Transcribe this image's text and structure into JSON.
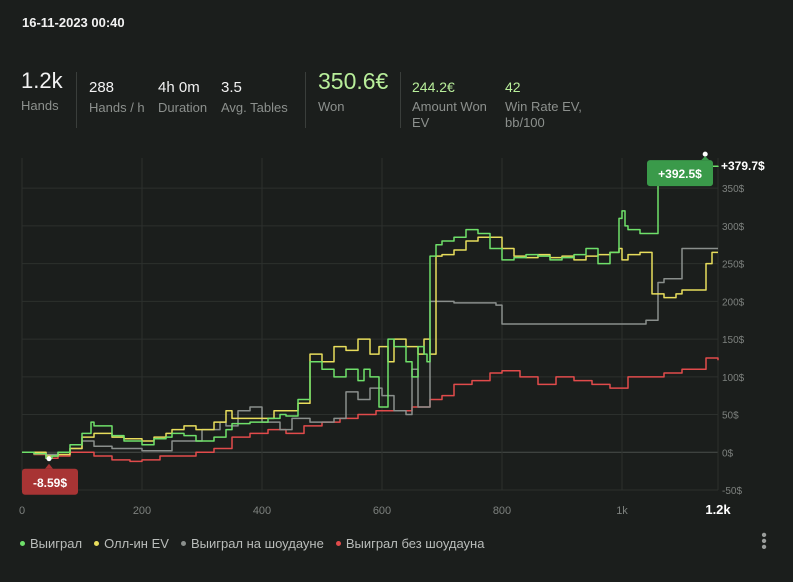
{
  "timestamp": "16-11-2023 00:40",
  "stats": {
    "hands": {
      "value": "1.2k",
      "label": "Hands"
    },
    "hands_per_hour": {
      "value": "288",
      "label": "Hands / h"
    },
    "duration": {
      "value": "4h 0m",
      "label": "Duration"
    },
    "avg_tables": {
      "value": "3.5",
      "label": "Avg. Tables"
    },
    "won": {
      "value": "350.6€",
      "label": "Won"
    },
    "amount_won_ev": {
      "value": "244.2€",
      "label_line1": "Amount Won",
      "label_line2": "EV"
    },
    "win_rate_ev": {
      "value": "42",
      "label_line1": "Win Rate EV,",
      "label_line2": "bb/100"
    }
  },
  "chart_data": {
    "type": "line",
    "x_ticks": [
      {
        "v": 0,
        "label": "0"
      },
      {
        "v": 200,
        "label": "200"
      },
      {
        "v": 400,
        "label": "400"
      },
      {
        "v": 600,
        "label": "600"
      },
      {
        "v": 800,
        "label": "800"
      },
      {
        "v": 1000,
        "label": "1k"
      },
      {
        "v": 1160,
        "label": "1.2k"
      }
    ],
    "y_ticks": [
      {
        "v": 350,
        "label": "350$"
      },
      {
        "v": 300,
        "label": "300$"
      },
      {
        "v": 250,
        "label": "250$"
      },
      {
        "v": 200,
        "label": "200$"
      },
      {
        "v": 150,
        "label": "150$"
      },
      {
        "v": 100,
        "label": "100$"
      },
      {
        "v": 50,
        "label": "50$"
      },
      {
        "v": 0,
        "label": "0$"
      },
      {
        "v": -50,
        "label": "-50$"
      }
    ],
    "xlim": [
      0,
      1160
    ],
    "ylim": [
      -50,
      390
    ],
    "max_label": "+392.5$",
    "min_label": "-8.59$",
    "end_label": "+379.7$",
    "max_point": {
      "x": 1142,
      "y": 392.5
    },
    "min_point": {
      "x": 45,
      "y": -8.59
    },
    "series": [
      {
        "name": "Выиграл",
        "color": "#6fe06a",
        "x": [
          0,
          20,
          40,
          50,
          60,
          80,
          100,
          115,
          120,
          150,
          170,
          200,
          220,
          240,
          250,
          270,
          290,
          320,
          340,
          350,
          380,
          390,
          410,
          430,
          440,
          460,
          480,
          500,
          520,
          540,
          560,
          570,
          580,
          595,
          610,
          620,
          640,
          650,
          660,
          670,
          675,
          680,
          690,
          700,
          720,
          740,
          760,
          780,
          800,
          820,
          840,
          860,
          880,
          900,
          920,
          940,
          960,
          980,
          995,
          1000,
          1005,
          1010,
          1030,
          1060,
          1080,
          1100,
          1120,
          1130,
          1142,
          1150,
          1160
        ],
        "y": [
          0,
          -2,
          -8,
          -5,
          0,
          10,
          25,
          40,
          35,
          22,
          15,
          10,
          18,
          20,
          25,
          22,
          15,
          20,
          30,
          38,
          40,
          40,
          45,
          50,
          48,
          70,
          120,
          110,
          100,
          110,
          95,
          110,
          100,
          60,
          150,
          140,
          120,
          100,
          140,
          130,
          120,
          260,
          275,
          280,
          285,
          295,
          290,
          270,
          255,
          258,
          262,
          260,
          255,
          258,
          262,
          270,
          250,
          265,
          310,
          320,
          300,
          295,
          290,
          360,
          370,
          375,
          378,
          380,
          380,
          379,
          379.7
        ]
      },
      {
        "name": "Олл-ин EV",
        "color": "#e8dd5c",
        "x": [
          0,
          40,
          60,
          80,
          100,
          120,
          150,
          170,
          200,
          220,
          240,
          250,
          270,
          290,
          320,
          340,
          350,
          380,
          400,
          420,
          440,
          460,
          480,
          500,
          520,
          540,
          560,
          580,
          595,
          610,
          620,
          640,
          660,
          670,
          680,
          690,
          700,
          720,
          740,
          760,
          780,
          800,
          820,
          840,
          860,
          880,
          900,
          920,
          940,
          960,
          980,
          995,
          1000,
          1010,
          1030,
          1050,
          1070,
          1090,
          1100,
          1110,
          1120,
          1140,
          1150,
          1160
        ],
        "y": [
          0,
          -5,
          -3,
          5,
          20,
          25,
          20,
          18,
          15,
          20,
          25,
          30,
          35,
          30,
          40,
          55,
          45,
          45,
          45,
          55,
          55,
          65,
          130,
          120,
          140,
          135,
          150,
          130,
          140,
          120,
          150,
          140,
          130,
          150,
          130,
          260,
          262,
          268,
          280,
          285,
          285,
          270,
          260,
          258,
          262,
          258,
          260,
          255,
          260,
          262,
          265,
          270,
          255,
          262,
          265,
          210,
          205,
          210,
          215,
          215,
          215,
          250,
          265,
          265
        ]
      },
      {
        "name": "Выиграл на шоудауне",
        "color": "#8a8f8c",
        "x": [
          0,
          40,
          60,
          80,
          100,
          120,
          150,
          200,
          250,
          300,
          330,
          340,
          360,
          380,
          400,
          430,
          450,
          480,
          500,
          520,
          540,
          560,
          580,
          600,
          620,
          640,
          650,
          660,
          680,
          700,
          720,
          740,
          760,
          790,
          800,
          820,
          840,
          860,
          880,
          900,
          920,
          940,
          960,
          980,
          1000,
          1020,
          1040,
          1060,
          1070,
          1080,
          1100,
          1120,
          1140,
          1150,
          1160
        ],
        "y": [
          0,
          -3,
          0,
          5,
          15,
          8,
          5,
          2,
          15,
          30,
          40,
          35,
          55,
          60,
          40,
          30,
          45,
          40,
          40,
          45,
          80,
          70,
          85,
          75,
          55,
          50,
          110,
          60,
          200,
          200,
          198,
          198,
          198,
          195,
          170,
          170,
          170,
          170,
          170,
          170,
          170,
          170,
          170,
          170,
          170,
          170,
          175,
          225,
          230,
          230,
          270,
          270,
          270,
          270,
          270
        ]
      },
      {
        "name": "Выиграл без шоудауна",
        "color": "#e14b4b",
        "x": [
          0,
          20,
          40,
          60,
          80,
          100,
          120,
          150,
          180,
          200,
          230,
          260,
          290,
          320,
          350,
          380,
          410,
          440,
          470,
          500,
          530,
          560,
          590,
          620,
          650,
          680,
          700,
          720,
          750,
          780,
          800,
          830,
          860,
          890,
          920,
          950,
          980,
          1010,
          1040,
          1070,
          1100,
          1120,
          1140,
          1150,
          1160
        ],
        "y": [
          0,
          -3,
          -8,
          -5,
          0,
          0,
          -5,
          -10,
          -12,
          -10,
          -5,
          -5,
          0,
          5,
          20,
          25,
          30,
          25,
          35,
          40,
          45,
          50,
          55,
          55,
          60,
          70,
          75,
          90,
          95,
          105,
          108,
          100,
          90,
          100,
          95,
          90,
          85,
          100,
          100,
          105,
          110,
          110,
          125,
          125,
          122
        ]
      }
    ]
  },
  "legend": [
    {
      "label": "Выиграл",
      "color": "#6fe06a"
    },
    {
      "label": "Олл-ин EV",
      "color": "#e8dd5c"
    },
    {
      "label": "Выиграл на шоудауне",
      "color": "#8a8f8c"
    },
    {
      "label": "Выиграл без шоудауна",
      "color": "#e14b4b"
    }
  ],
  "menu_icon": "vertical-dots-icon"
}
